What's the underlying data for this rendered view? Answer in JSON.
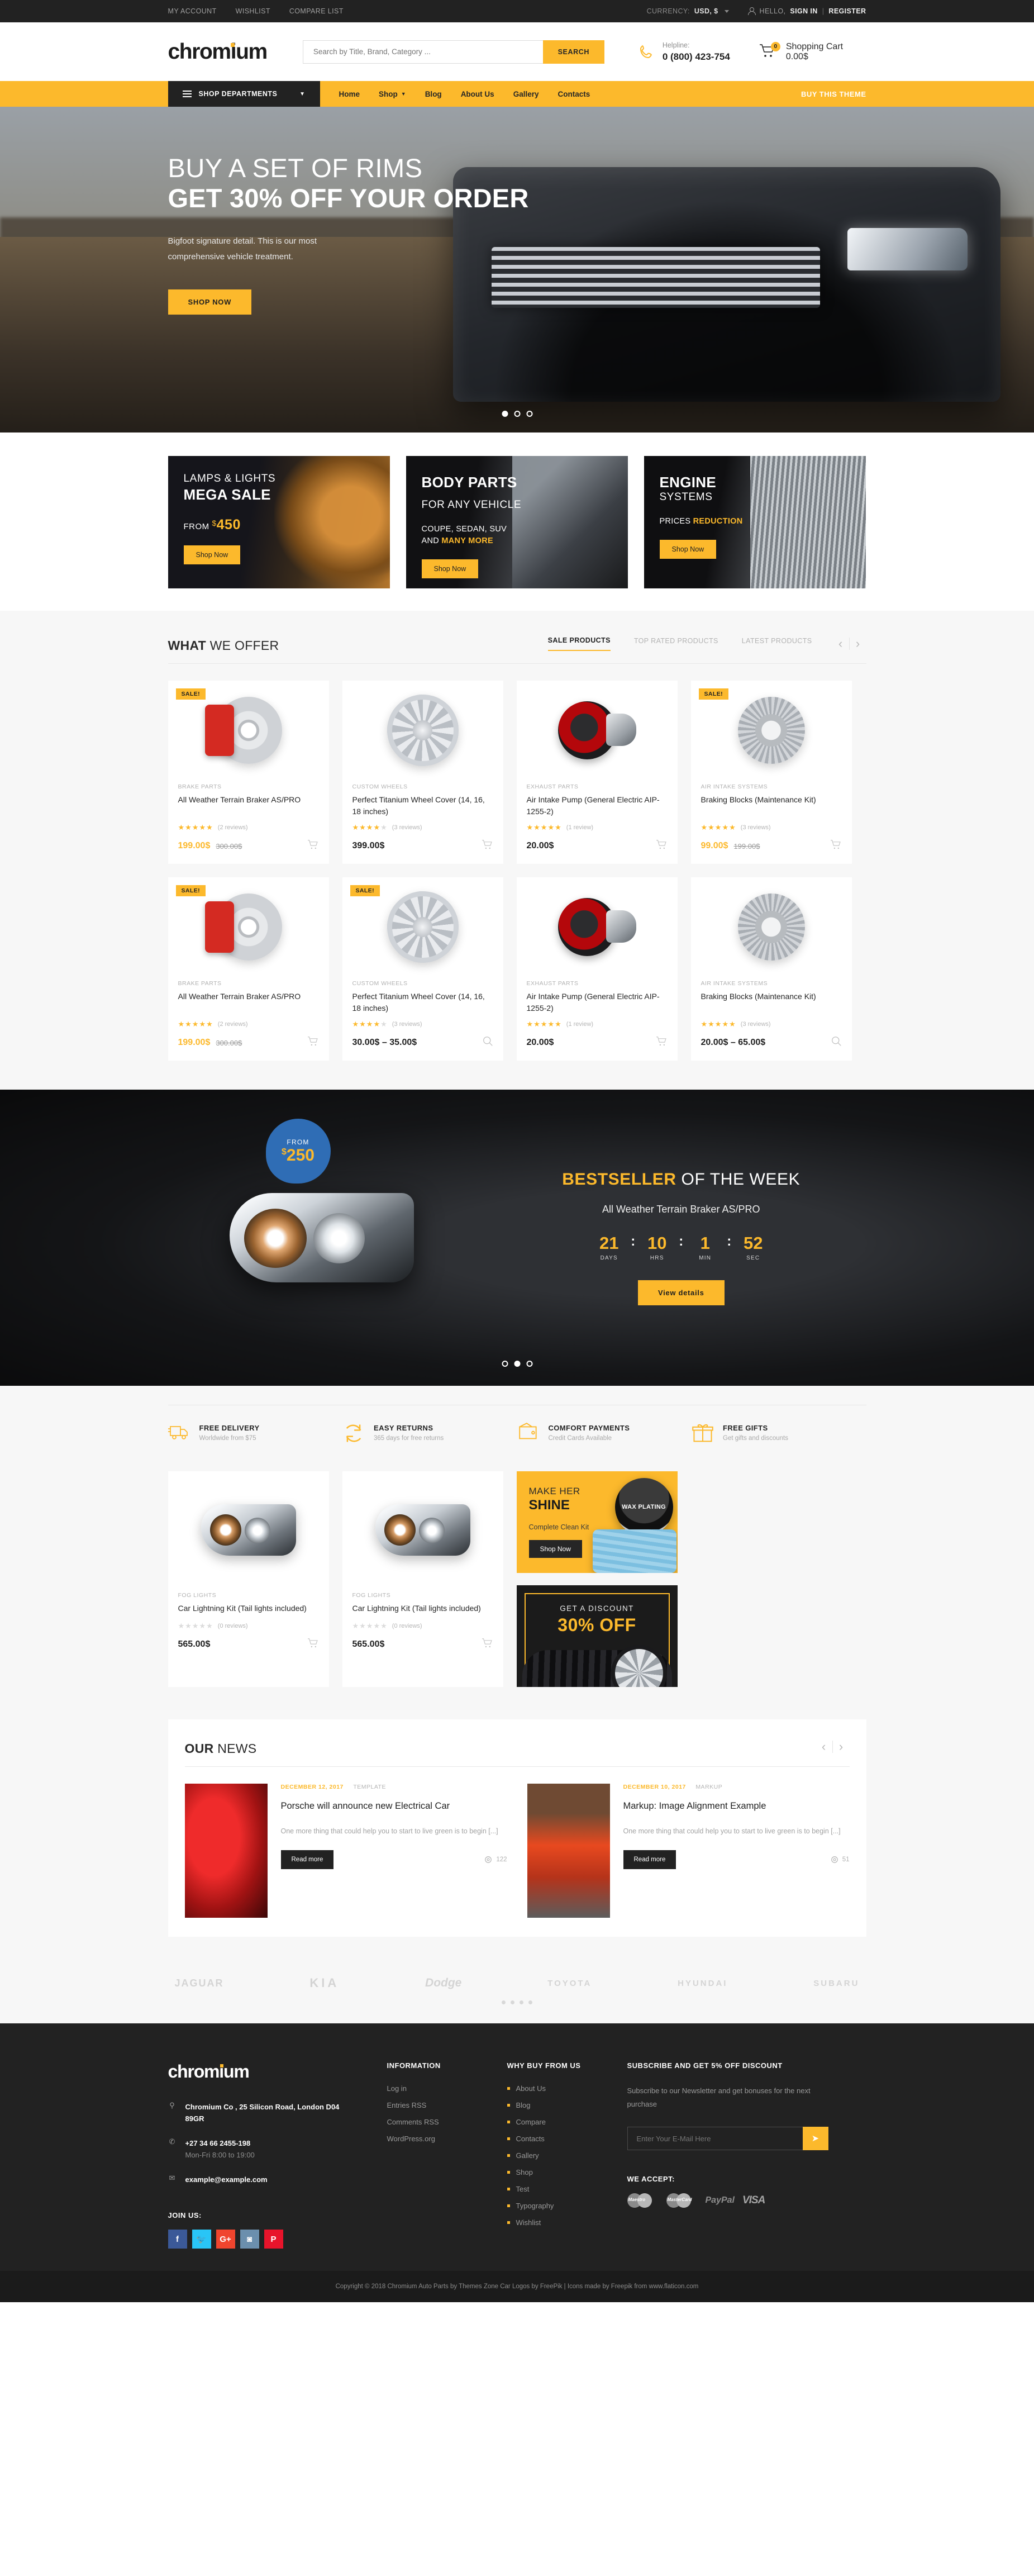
{
  "topbar": {
    "links": [
      "MY ACCOUNT",
      "WISHLIST",
      "COMPARE LIST"
    ],
    "currency_label": "CURRENCY:",
    "currency_value": "USD, $",
    "greeting": "HELLO,",
    "sign_in": "SIGN IN",
    "separator": "|",
    "register": "REGISTER"
  },
  "header": {
    "logo": "chromium",
    "search_placeholder": "Search by Title, Brand, Category ...",
    "search_button": "SEARCH",
    "helpline_label": "Helpline:",
    "helpline_number": "0 (800) 423-754",
    "cart_label": "Shopping Cart",
    "cart_total": "0.00$",
    "cart_count": "0"
  },
  "nav": {
    "departments": "SHOP DEPARTMENTS",
    "items": [
      "Home",
      "Shop",
      "Blog",
      "About Us",
      "Gallery",
      "Contacts"
    ],
    "buy_theme": "BUY THIS THEME"
  },
  "hero": {
    "line1": "BUY A SET OF RIMS",
    "line2": "GET 30% OFF YOUR ORDER",
    "desc": "Bigfoot signature detail. This is our most comprehensive vehicle treatment.",
    "cta": "SHOP NOW"
  },
  "promos": [
    {
      "top": "LAMPS & LIGHTS",
      "title": "MEGA SALE",
      "from_label": "FROM",
      "currency": "$",
      "price": "450",
      "cta": "Shop Now"
    },
    {
      "top": "",
      "title": "BODY PARTS",
      "sub": "FOR ANY VEHICLE",
      "line_a": "COUPE, SEDAN, SUV",
      "line_b_plain": "AND ",
      "line_b_accent": "MANY MORE",
      "cta": "Shop Now"
    },
    {
      "top": "ENGINE",
      "title": "SYSTEMS",
      "line_plain": "PRICES ",
      "line_accent": "REDUCTION",
      "cta": "Shop Now"
    }
  ],
  "offer": {
    "title_bold": "WHAT",
    "title_light": " WE OFFER",
    "tabs": [
      "SALE PRODUCTS",
      "TOP RATED PRODUCTS",
      "LATEST PRODUCTS"
    ],
    "active_tab": "SALE PRODUCTS",
    "products": [
      {
        "badge": "SALE!",
        "category": "BRAKE PARTS",
        "name": "All Weather Terrain Braker AS/PRO",
        "rating": 4.5,
        "reviews": "(2 reviews)",
        "price": "199.00$",
        "old_price": "300.00$",
        "action": "cart-icon",
        "art": "rotor-caliper"
      },
      {
        "badge": "",
        "category": "CUSTOM WHEELS",
        "name": "Perfect Titanium Wheel Cover (14, 16, 18 inches)",
        "rating": 4,
        "reviews": "(3 reviews)",
        "price": "399.00$",
        "old_price": "",
        "action": "cart-icon",
        "art": "wheelcover"
      },
      {
        "badge": "",
        "category": "EXHAUST PARTS",
        "name": "Air Intake Pump (General Electric AIP-1255-2)",
        "rating": 5,
        "reviews": "(1 review)",
        "price": "20.00$",
        "old_price": "",
        "action": "cart-icon",
        "art": "turbo"
      },
      {
        "badge": "SALE!",
        "category": "AIR INTAKE SYSTEMS",
        "name": "Braking Blocks (Maintenance Kit)",
        "rating": 4.5,
        "reviews": "(3 reviews)",
        "price": "99.00$",
        "old_price": "199.00$",
        "action": "cart-icon",
        "art": "rotor-slots"
      },
      {
        "badge": "SALE!",
        "category": "BRAKE PARTS",
        "name": "All Weather Terrain Braker AS/PRO",
        "rating": 4.5,
        "reviews": "(2 reviews)",
        "price": "199.00$",
        "old_price": "300.00$",
        "action": "cart-icon",
        "art": "rotor-caliper"
      },
      {
        "badge": "SALE!",
        "category": "CUSTOM WHEELS",
        "name": "Perfect Titanium Wheel Cover (14, 16, 18 inches)",
        "rating": 4,
        "reviews": "(3 reviews)",
        "price": "30.00$ – 35.00$",
        "old_price": "",
        "action": "search-icon",
        "art": "wheelcover"
      },
      {
        "badge": "",
        "category": "EXHAUST PARTS",
        "name": "Air Intake Pump (General Electric AIP-1255-2)",
        "rating": 5,
        "reviews": "(1 review)",
        "price": "20.00$",
        "old_price": "",
        "action": "cart-icon",
        "art": "turbo"
      },
      {
        "badge": "",
        "category": "AIR INTAKE SYSTEMS",
        "name": "Braking Blocks (Maintenance Kit)",
        "rating": 4.5,
        "reviews": "(3 reviews)",
        "price": "20.00$ – 65.00$",
        "old_price": "",
        "action": "search-icon",
        "art": "rotor-slots"
      }
    ]
  },
  "bestseller": {
    "bubble_from": "FROM",
    "bubble_currency": "$",
    "bubble_price": "250",
    "title_bold": "BESTSELLER",
    "title_light": " OF THE WEEK",
    "product": "All Weather Terrain Braker AS/PRO",
    "countdown": [
      {
        "value": "21",
        "label": "DAYS"
      },
      {
        "value": "10",
        "label": "HRS"
      },
      {
        "value": "1",
        "label": "MIN"
      },
      {
        "value": "52",
        "label": "SEC"
      }
    ],
    "cta": "View details"
  },
  "features": [
    {
      "icon": "truck-icon",
      "title": "FREE DELIVERY",
      "desc": "Worldwide from $75"
    },
    {
      "icon": "refresh-icon",
      "title": "EASY RETURNS",
      "desc": "365 days for free returns"
    },
    {
      "icon": "wallet-icon",
      "title": "COMFORT PAYMENTS",
      "desc": "Credit Cards Available"
    },
    {
      "icon": "gift-icon",
      "title": "FREE GIFTS",
      "desc": "Get gifts and discounts"
    }
  ],
  "mid_products": [
    {
      "category": "FOG LIGHTS",
      "name": "Car Lightning Kit (Tail lights included)",
      "rating": 0,
      "reviews": "(0 reviews)",
      "price": "565.00$",
      "action": "cart-icon"
    },
    {
      "category": "FOG LIGHTS",
      "name": "Car Lightning Kit (Tail lights included)",
      "rating": 0,
      "reviews": "(0 reviews)",
      "price": "565.00$",
      "action": "cart-icon"
    }
  ],
  "side_promos": {
    "shine": {
      "line1": "MAKE HER",
      "line2": "SHINE",
      "line3": "Complete Clean Kit",
      "cta": "Shop Now",
      "product_label": "WAX PLATING"
    },
    "discount": {
      "line1": "GET A DISCOUNT",
      "line2": "30% OFF"
    }
  },
  "news": {
    "title_bold": "OUR",
    "title_light": " NEWS",
    "posts": [
      {
        "date": "DECEMBER 12, 2017",
        "category": "TEMPLATE",
        "title": "Porsche will announce new Electrical Car",
        "excerpt": "One more thing that could help you to start to live green is to begin [...]",
        "cta": "Read more",
        "views": "122"
      },
      {
        "date": "DECEMBER 10, 2017",
        "category": "MARKUP",
        "title": "Markup: Image Alignment Example",
        "excerpt": "One more thing that could help you to start to live green is to begin [...]",
        "cta": "Read more",
        "views": "51"
      }
    ]
  },
  "brands": [
    "JAGUAR",
    "KIA",
    "Dodge",
    "TOYOTA",
    "HYUNDAI",
    "SUBARU"
  ],
  "footer": {
    "logo": "chromium",
    "address": "Chromium Co , 25 Silicon Road, London D04 89GR",
    "phone": "+27 34 66 2455-198",
    "hours": "Mon-Fri 8:00 to 19:00",
    "email": "example@example.com",
    "join_us": "JOIN US:",
    "socials": [
      "facebook-icon",
      "twitter-icon",
      "google-plus-icon",
      "instagram-icon",
      "pinterest-icon"
    ],
    "information_title": "INFORMATION",
    "information_links": [
      "Log in",
      "Entries RSS",
      "Comments RSS",
      "WordPress.org"
    ],
    "why_title": "WHY BUY FROM US",
    "why_links": [
      "About Us",
      "Blog",
      "Compare",
      "Contacts",
      "Gallery",
      "Shop",
      "Test",
      "Typography",
      "Wishlist"
    ],
    "subscribe_title": "SUBSCRIBE AND GET 5% OFF DISCOUNT",
    "subscribe_text": "Subscribe to our Newsletter and get bonuses for the next purchase",
    "subscribe_placeholder": "Enter Your E-Mail Here",
    "we_accept": "WE ACCEPT:",
    "payments": [
      "Maestro",
      "MasterCard",
      "PayPal",
      "VISA"
    ],
    "copyright": "Copyright © 2018  Chromium Auto Parts by Themes Zone Car Logos by FreePik | Icons made by Freepik from www.flaticon.com"
  },
  "colors": {
    "accent": "#fcb92c",
    "dark": "#222222",
    "bg": "#f7f7f7"
  }
}
